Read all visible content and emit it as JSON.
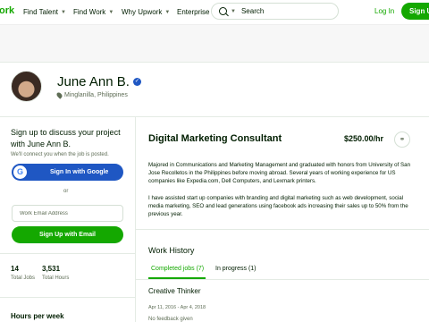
{
  "nav": {
    "logo": "ork",
    "links": [
      {
        "label": "Find Talent",
        "has_dropdown": true
      },
      {
        "label": "Find Work",
        "has_dropdown": true
      },
      {
        "label": "Why Upwork",
        "has_dropdown": true
      },
      {
        "label": "Enterprise",
        "has_dropdown": false
      }
    ],
    "search": {
      "placeholder": "Search"
    },
    "login_label": "Log In",
    "signup_label": "Sign Up"
  },
  "profile": {
    "name": "June Ann B.",
    "location": "Minglanilla, Philippines",
    "verified_icon": "verified-badge-icon"
  },
  "signup_panel": {
    "title": "Sign up to discuss your project with June Ann B.",
    "subtitle": "We'll connect you when the job is posted.",
    "google_button": "Sign In with Google",
    "or_label": "or",
    "email_placeholder": "Work Email Address",
    "email_button": "Sign Up with Email"
  },
  "stats": [
    {
      "value": "14",
      "label": "Total Jobs"
    },
    {
      "value": "3,531",
      "label": "Total Hours"
    }
  ],
  "hours_per_week_label": "Hours per week",
  "job": {
    "title": "Digital Marketing Consultant",
    "rate": "$250.00/hr",
    "paragraphs": [
      "Majored in Communications and Marketing Management and graduated with honors from University of San Jose Recolletos in the Philippines before moving abroad. Several years of working experience for US companies like Expedia.com, Dell Computers, and Lexmark printers.",
      "I have assisted start up companies with branding and digital marketing such as web development, social media marketing, SEO and lead generations using facebook ads increasing their sales up to 50% from the previous year."
    ]
  },
  "work_history": {
    "title": "Work History",
    "tabs": [
      {
        "label": "Completed jobs (7)",
        "active": true
      },
      {
        "label": "In progress (1)",
        "active": false
      }
    ],
    "jobs": [
      {
        "client": "Creative Thinker",
        "dates": "Apr 11, 2016 - Apr 4, 2018",
        "feedback": "No feedback given"
      }
    ]
  },
  "colors": {
    "brand_green": "#14a800",
    "google_blue": "#1f57c3",
    "text": "#001e00",
    "muted": "#5e6d55"
  }
}
